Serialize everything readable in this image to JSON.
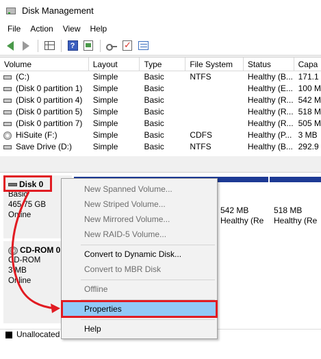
{
  "window": {
    "title": "Disk Management"
  },
  "menu": [
    "File",
    "Action",
    "View",
    "Help"
  ],
  "toolbar": [
    "back-icon",
    "forward-icon",
    "grid-icon",
    "help-icon",
    "sheet-icon",
    "key-icon",
    "check-icon",
    "list-icon"
  ],
  "volume_list": {
    "headers": [
      "Volume",
      "Layout",
      "Type",
      "File System",
      "Status",
      "Capa"
    ],
    "rows": [
      {
        "volume": "(C:)",
        "layout": "Simple",
        "type": "Basic",
        "fs": "NTFS",
        "status": "Healthy (B...",
        "capacity": "171.1"
      },
      {
        "volume": "(Disk 0 partition 1)",
        "layout": "Simple",
        "type": "Basic",
        "fs": "",
        "status": "Healthy (E...",
        "capacity": "100 M"
      },
      {
        "volume": "(Disk 0 partition 4)",
        "layout": "Simple",
        "type": "Basic",
        "fs": "",
        "status": "Healthy (R...",
        "capacity": "542 M"
      },
      {
        "volume": "(Disk 0 partition 5)",
        "layout": "Simple",
        "type": "Basic",
        "fs": "",
        "status": "Healthy (R...",
        "capacity": "518 M"
      },
      {
        "volume": "(Disk 0 partition 7)",
        "layout": "Simple",
        "type": "Basic",
        "fs": "",
        "status": "Healthy (R...",
        "capacity": "505 M"
      },
      {
        "volume": "HiSuite (F:)",
        "layout": "Simple",
        "type": "Basic",
        "fs": "CDFS",
        "status": "Healthy (P...",
        "capacity": "3 MB"
      },
      {
        "volume": "Save Drive (D:)",
        "layout": "Simple",
        "type": "Basic",
        "fs": "NTFS",
        "status": "Healthy (B...",
        "capacity": "292.9"
      }
    ]
  },
  "disks": {
    "disk0": {
      "name": "Disk 0",
      "type": "Basic",
      "size": "465.75 GB",
      "status": "Online"
    },
    "cdrom0": {
      "name": "CD-ROM 0",
      "type": "CD-ROM",
      "size": "3 MB",
      "status": "Online"
    },
    "partitions": [
      {
        "size": "542 MB",
        "status": "Healthy (Re"
      },
      {
        "size": "518 MB",
        "status": "Healthy (Re"
      }
    ]
  },
  "legend": {
    "unallocated": "Unallocated"
  },
  "context_menu": {
    "new_spanned": "New Spanned Volume...",
    "new_striped": "New Striped Volume...",
    "new_mirrored": "New Mirrored Volume...",
    "new_raid5": "New RAID-5 Volume...",
    "convert_dynamic": "Convert to Dynamic Disk...",
    "convert_mbr": "Convert to MBR Disk",
    "offline": "Offline",
    "properties": "Properties",
    "help": "Help"
  },
  "colors": {
    "partition_bar": "#1d3a94",
    "highlight": "#91c9f7",
    "annotation": "#e11b22"
  }
}
